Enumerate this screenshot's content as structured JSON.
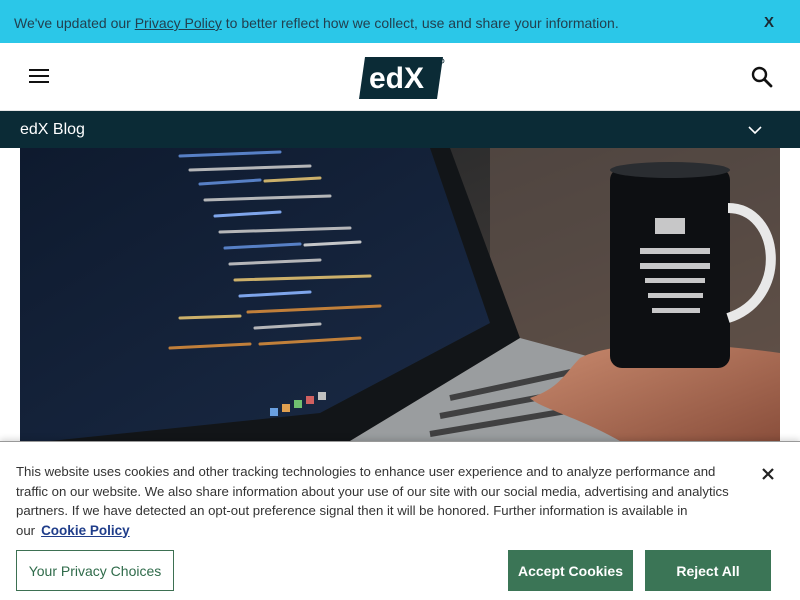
{
  "notice": {
    "text_before": "We've updated our ",
    "link": "Privacy Policy",
    "text_after": " to better reflect how we collect, use and share your information.",
    "close": "X"
  },
  "header": {
    "logo_text": "edX"
  },
  "blogbar": {
    "title": "edX Blog"
  },
  "cookie": {
    "text": "This website uses cookies and other tracking technologies to enhance user experience and to analyze performance and traffic on our website. We also share information about your use of our site with our social media, advertising and analytics partners. If we have detected an opt-out preference signal then it will be honored. Further information is available in our",
    "policy_link": "Cookie Policy",
    "privacy_choices": "Your Privacy Choices",
    "accept": "Accept Cookies",
    "reject": "Reject All"
  },
  "colors": {
    "notice_bg": "#2bc7e8",
    "blogbar_bg": "#0b2b36",
    "button_green": "#3b7556"
  }
}
